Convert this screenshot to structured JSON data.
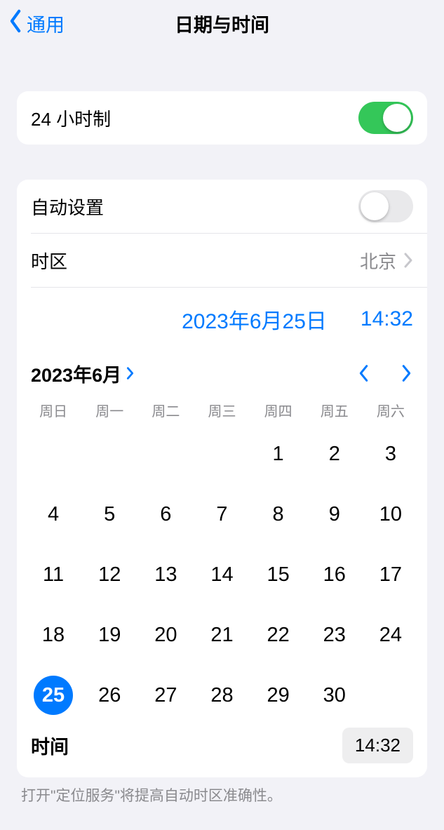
{
  "nav": {
    "back": "通用",
    "title": "日期与时间"
  },
  "row24h": {
    "label": "24 小时制",
    "on": true
  },
  "auto": {
    "label": "自动设置",
    "on": false
  },
  "tz": {
    "label": "时区",
    "value": "北京"
  },
  "datetime": {
    "date": "2023年6月25日",
    "time": "14:32"
  },
  "cal": {
    "title": "2023年6月",
    "weekdays": [
      "周日",
      "周一",
      "周二",
      "周三",
      "周四",
      "周五",
      "周六"
    ],
    "selected": 25,
    "weeks": [
      [
        0,
        0,
        0,
        0,
        1,
        2,
        3
      ],
      [
        4,
        5,
        6,
        7,
        8,
        9,
        10
      ],
      [
        11,
        12,
        13,
        14,
        15,
        16,
        17
      ],
      [
        18,
        19,
        20,
        21,
        22,
        23,
        24
      ],
      [
        25,
        26,
        27,
        28,
        29,
        30,
        0
      ]
    ]
  },
  "timerow": {
    "label": "时间",
    "value": "14:32"
  },
  "footer": "打开\"定位服务\"将提高自动时区准确性。"
}
